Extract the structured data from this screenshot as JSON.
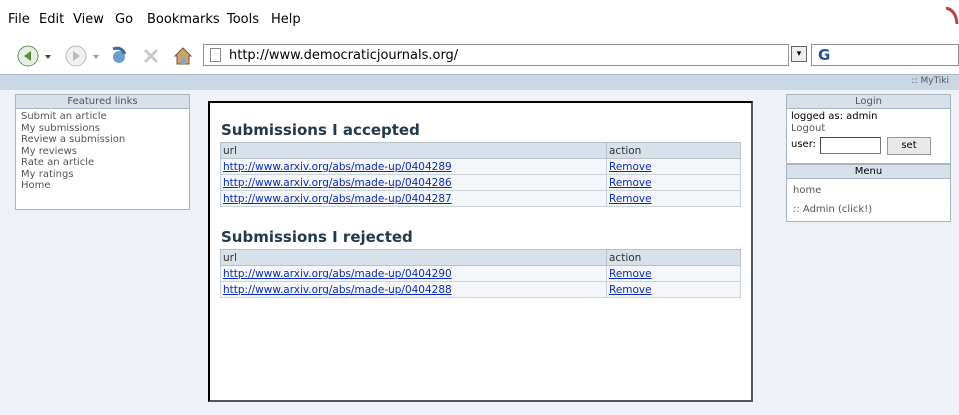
{
  "browser": {
    "menu": [
      "File",
      "Edit",
      "View",
      "Go",
      "Bookmarks",
      "Tools",
      "Help"
    ],
    "url": "http://www.democraticjournals.org/",
    "search_logo": "G"
  },
  "site": {
    "top_link": ":: MyTiki"
  },
  "featured": {
    "title": "Featured links",
    "items": [
      "Submit an article",
      "My submissions",
      "Review a submission",
      "My reviews",
      "Rate an article",
      "My ratings",
      "Home"
    ]
  },
  "accepted": {
    "title": "Submissions I accepted",
    "col_url": "url",
    "col_action": "action",
    "rows": [
      {
        "url": "http://www.arxiv.org/abs/made-up/0404289",
        "action": "Remove"
      },
      {
        "url": "http://www.arxiv.org/abs/made-up/0404286",
        "action": "Remove"
      },
      {
        "url": "http://www.arxiv.org/abs/made-up/0404287",
        "action": "Remove"
      }
    ]
  },
  "rejected": {
    "title": "Submissions I rejected",
    "col_url": "url",
    "col_action": "action",
    "rows": [
      {
        "url": "http://www.arxiv.org/abs/made-up/0404290",
        "action": "Remove"
      },
      {
        "url": "http://www.arxiv.org/abs/made-up/0404288",
        "action": "Remove"
      }
    ]
  },
  "login": {
    "title": "Login",
    "logged_as": "logged as: admin",
    "logout": "Logout",
    "user_label": "user:",
    "set_label": "set"
  },
  "menu": {
    "title": "Menu",
    "items": [
      "home",
      ":: Admin (click!)"
    ]
  }
}
